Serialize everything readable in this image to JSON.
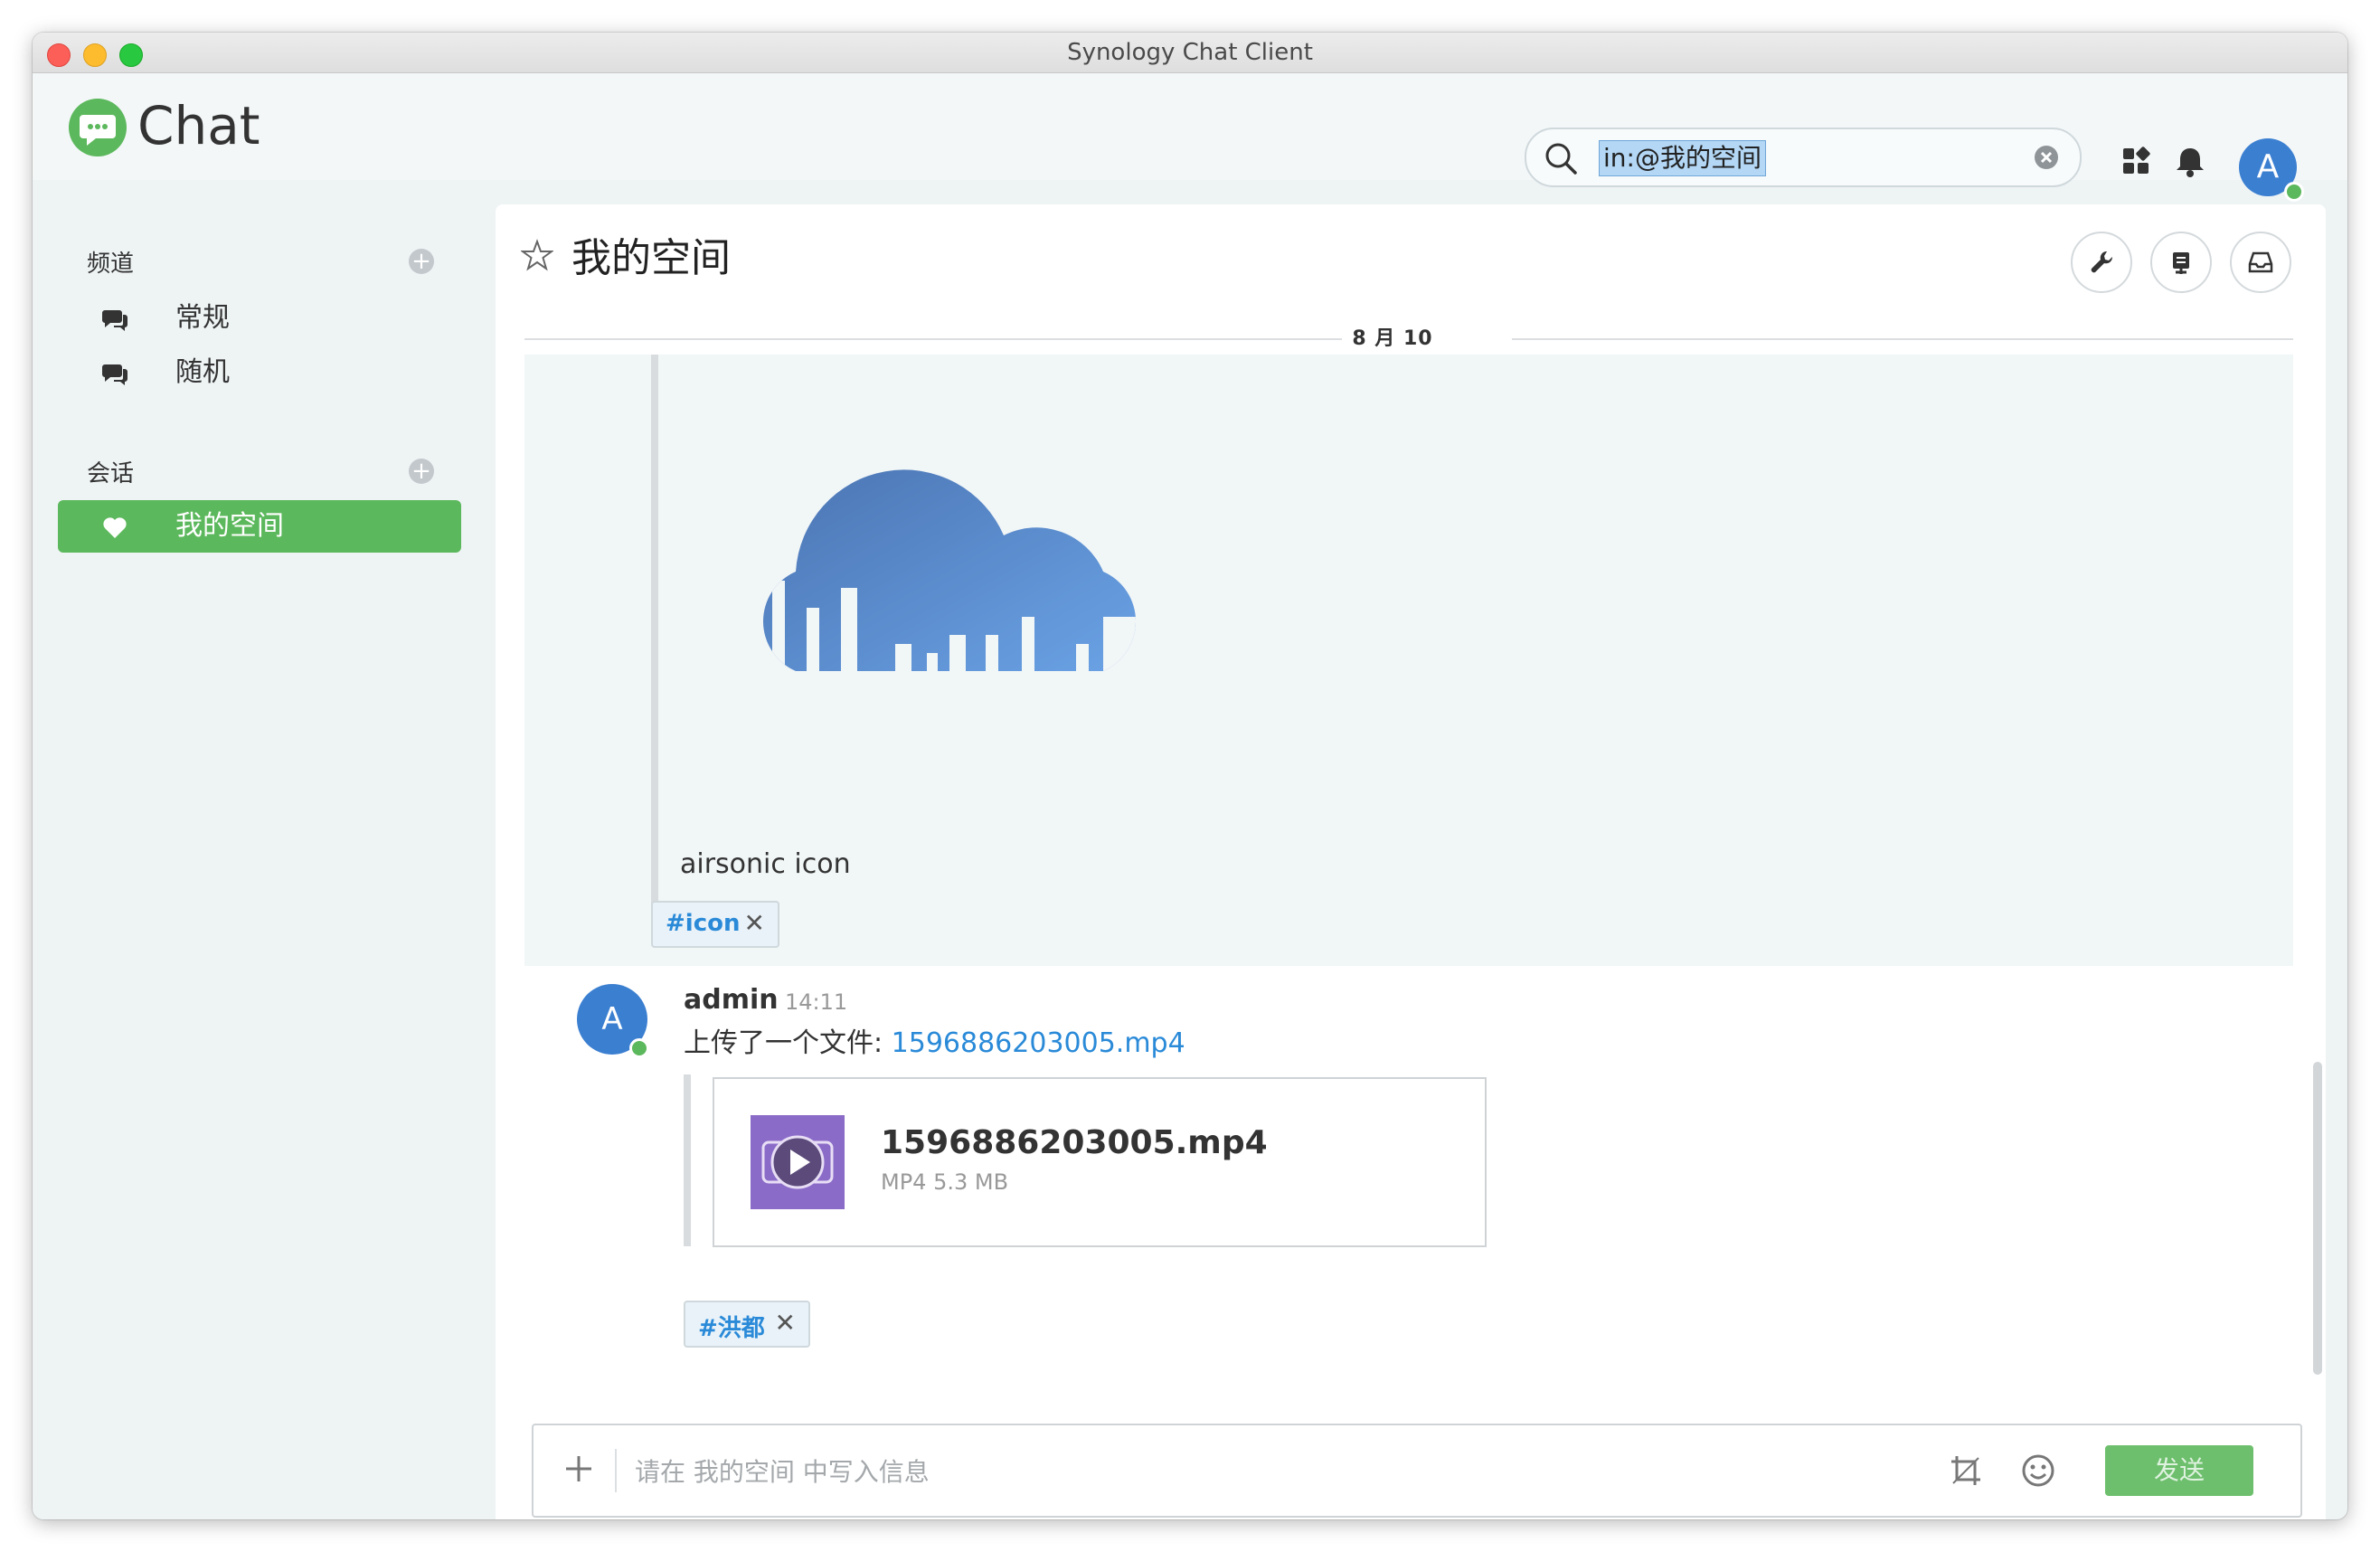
{
  "window": {
    "title": "Synology Chat Client"
  },
  "header": {
    "app_name": "Chat",
    "search_value": "in:@我的空间",
    "avatar_initial": "A"
  },
  "sidebar": {
    "channels_title": "频道",
    "channels": [
      {
        "label": "常规",
        "icon": "channel-icon"
      },
      {
        "label": "随机",
        "icon": "channel-icon"
      }
    ],
    "conversations_title": "会话",
    "conversations": [
      {
        "label": "我的空间",
        "icon": "heart-icon",
        "active": true
      }
    ]
  },
  "room": {
    "title": "我的空间",
    "date_divider": "8 月 10 日"
  },
  "messages": [
    {
      "image_caption": "airsonic icon",
      "tag": "#icon"
    },
    {
      "avatar_initial": "A",
      "author": "admin",
      "time": "14:11",
      "text_prefix": "上传了一个文件: ",
      "link": "1596886203005.mp4",
      "file": {
        "name": "1596886203005.mp4",
        "meta": "MP4 5.3 MB"
      },
      "tag": "#洪都"
    }
  ],
  "composer": {
    "placeholder": "请在 我的空间 中写入信息",
    "send_label": "发送"
  },
  "colors": {
    "brand_green": "#5cb85c",
    "link_blue": "#2a8ad8",
    "avatar_blue": "#3b7fd1"
  }
}
